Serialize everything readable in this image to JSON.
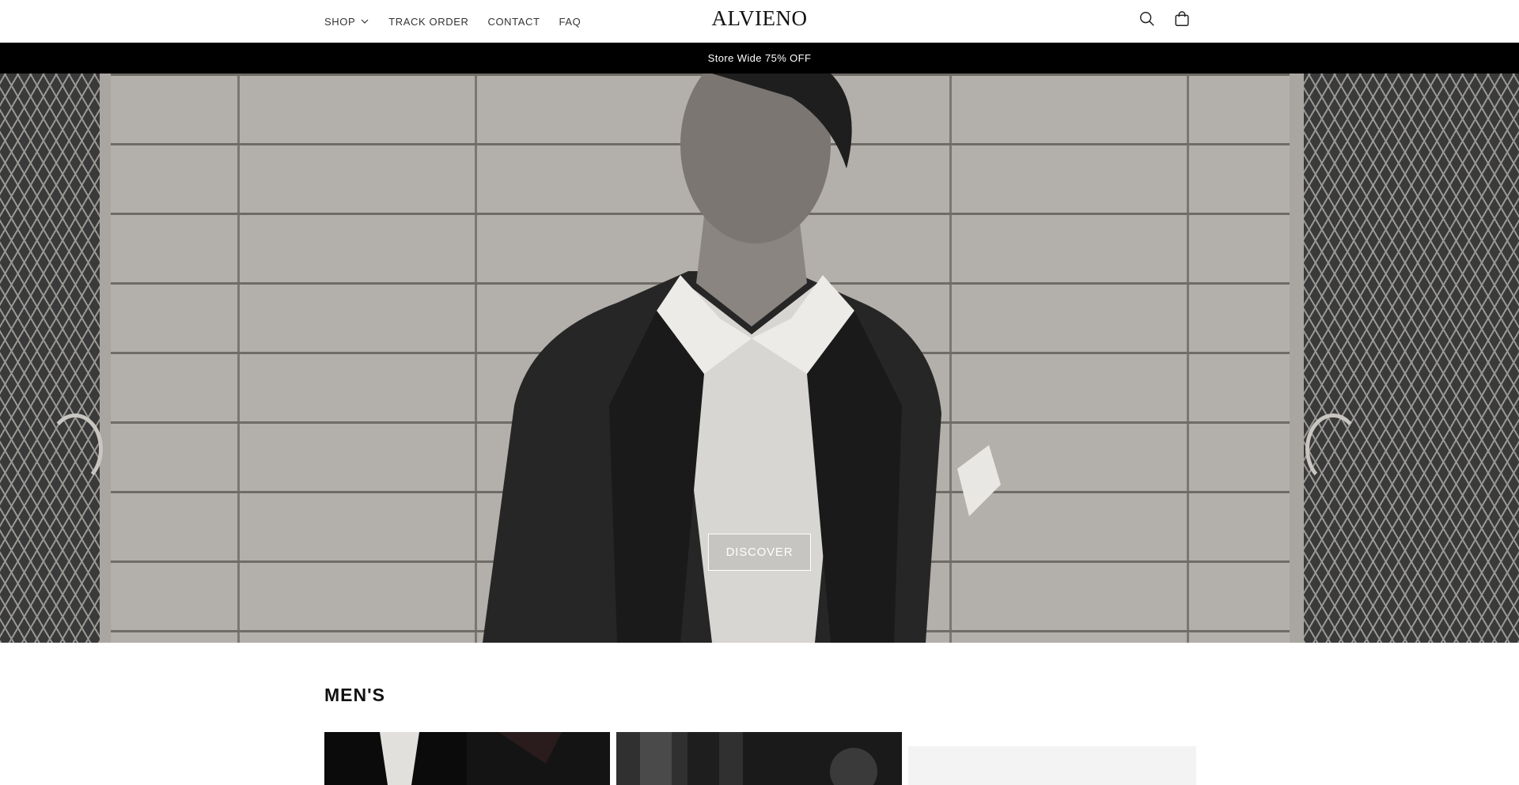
{
  "header": {
    "nav": [
      {
        "label": "SHOP",
        "has_dropdown": true
      },
      {
        "label": "TRACK ORDER"
      },
      {
        "label": "CONTACT"
      },
      {
        "label": "FAQ"
      }
    ],
    "logo": "ALVIENO",
    "icons": [
      "search-icon",
      "cart-icon"
    ]
  },
  "announcement": {
    "text": "Store Wide 75% OFF"
  },
  "hero": {
    "button_label": "DISCOVER"
  },
  "collection": {
    "title": "MEN'S"
  }
}
